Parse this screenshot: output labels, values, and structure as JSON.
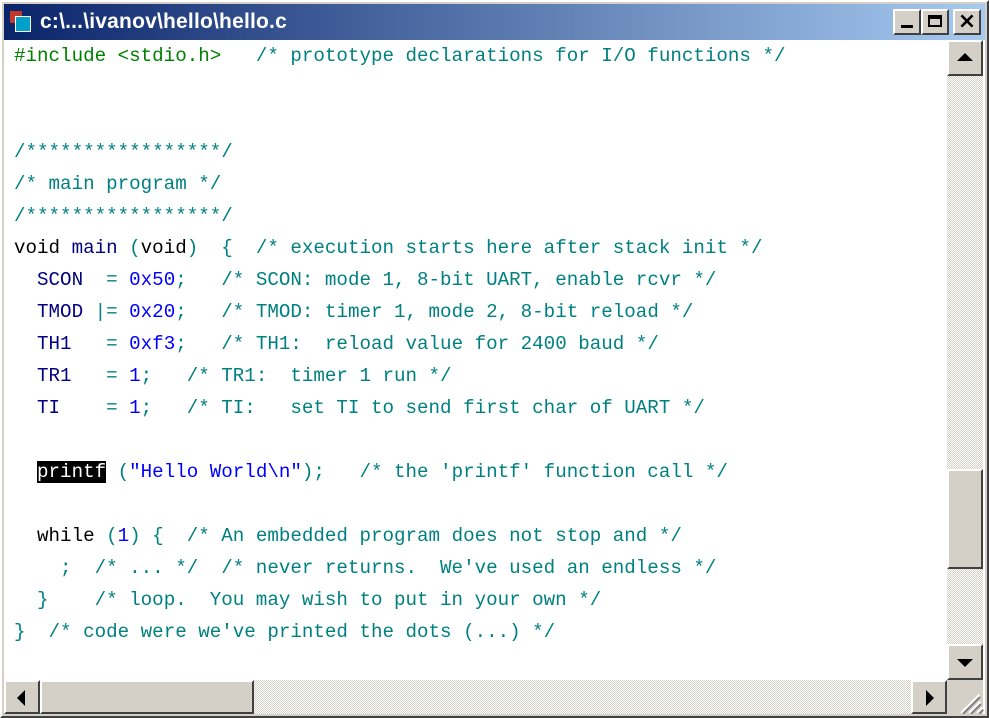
{
  "window": {
    "title": "c:\\...\\ivanov\\hello\\hello.c",
    "icon": "document-app-icon",
    "buttons": {
      "minimize": "minimize-icon",
      "maximize": "maximize-icon",
      "close": "×"
    }
  },
  "editor": {
    "colors": {
      "comment": "#008080",
      "preprocessor": "#008000",
      "keyword": "#000080",
      "number": "#0000ff",
      "selection": "#000000"
    },
    "lines": [
      {
        "tokens": [
          {
            "t": "#include <stdio.h>",
            "k": "pp"
          },
          {
            "t": "   ",
            "k": "op"
          },
          {
            "t": "/* prototype declarations for I/O functions */",
            "k": "cmt"
          }
        ]
      },
      {
        "tokens": []
      },
      {
        "tokens": []
      },
      {
        "tokens": [
          {
            "t": "/*****************/",
            "k": "cmt"
          }
        ]
      },
      {
        "tokens": [
          {
            "t": "/* main program */",
            "k": "cmt"
          }
        ]
      },
      {
        "tokens": [
          {
            "t": "/*****************/",
            "k": "cmt"
          }
        ]
      },
      {
        "tokens": [
          {
            "t": "void",
            "k": "op"
          },
          {
            "t": " ",
            "k": "op"
          },
          {
            "t": "main",
            "k": "kw"
          },
          {
            "t": " (",
            "k": "cmt"
          },
          {
            "t": "void",
            "k": "op"
          },
          {
            "t": ")  {  ",
            "k": "cmt"
          },
          {
            "t": "/* execution starts here after stack init */",
            "k": "cmt"
          }
        ]
      },
      {
        "tokens": [
          {
            "t": "  ",
            "k": "op"
          },
          {
            "t": "SCON",
            "k": "kw"
          },
          {
            "t": "  = ",
            "k": "cmt"
          },
          {
            "t": "0x50",
            "k": "num"
          },
          {
            "t": ";   ",
            "k": "cmt"
          },
          {
            "t": "/* SCON: mode 1, 8-bit UART, enable rcvr */",
            "k": "cmt"
          }
        ]
      },
      {
        "tokens": [
          {
            "t": "  ",
            "k": "op"
          },
          {
            "t": "TMOD",
            "k": "kw"
          },
          {
            "t": " |= ",
            "k": "cmt"
          },
          {
            "t": "0x20",
            "k": "num"
          },
          {
            "t": ";   ",
            "k": "cmt"
          },
          {
            "t": "/* TMOD: timer 1, mode 2, 8-bit reload */",
            "k": "cmt"
          }
        ]
      },
      {
        "tokens": [
          {
            "t": "  ",
            "k": "op"
          },
          {
            "t": "TH1",
            "k": "kw"
          },
          {
            "t": "   = ",
            "k": "cmt"
          },
          {
            "t": "0xf3",
            "k": "num"
          },
          {
            "t": ";   ",
            "k": "cmt"
          },
          {
            "t": "/* TH1:  reload value for 2400 baud */",
            "k": "cmt"
          }
        ]
      },
      {
        "tokens": [
          {
            "t": "  ",
            "k": "op"
          },
          {
            "t": "TR1",
            "k": "kw"
          },
          {
            "t": "   = ",
            "k": "cmt"
          },
          {
            "t": "1",
            "k": "num"
          },
          {
            "t": ";   ",
            "k": "cmt"
          },
          {
            "t": "/* TR1:  timer 1 run */",
            "k": "cmt"
          }
        ]
      },
      {
        "tokens": [
          {
            "t": "  ",
            "k": "op"
          },
          {
            "t": "TI",
            "k": "kw"
          },
          {
            "t": "    = ",
            "k": "cmt"
          },
          {
            "t": "1",
            "k": "num"
          },
          {
            "t": ";   ",
            "k": "cmt"
          },
          {
            "t": "/* TI:   set TI to send first char of UART */",
            "k": "cmt"
          }
        ]
      },
      {
        "tokens": []
      },
      {
        "tokens": [
          {
            "t": "  ",
            "k": "op"
          },
          {
            "t": "printf",
            "k": "sel"
          },
          {
            "t": " (",
            "k": "cmt"
          },
          {
            "t": "\"Hello World\\n\"",
            "k": "str"
          },
          {
            "t": ");   ",
            "k": "cmt"
          },
          {
            "t": "/* the 'printf' function call */",
            "k": "cmt"
          }
        ]
      },
      {
        "tokens": []
      },
      {
        "tokens": [
          {
            "t": "  ",
            "k": "op"
          },
          {
            "t": "while",
            "k": "op"
          },
          {
            "t": " (",
            "k": "cmt"
          },
          {
            "t": "1",
            "k": "num"
          },
          {
            "t": ") {  ",
            "k": "cmt"
          },
          {
            "t": "/* An embedded program does not stop and */",
            "k": "cmt"
          }
        ]
      },
      {
        "tokens": [
          {
            "t": "    ;  ",
            "k": "cmt"
          },
          {
            "t": "/* ... */  /* never returns.  We've used an endless */",
            "k": "cmt"
          }
        ]
      },
      {
        "tokens": [
          {
            "t": "  }    ",
            "k": "cmt"
          },
          {
            "t": "/* loop.  You may wish to put in your own */",
            "k": "cmt"
          }
        ]
      },
      {
        "tokens": [
          {
            "t": "}  ",
            "k": "cmt"
          },
          {
            "t": "/* code were we've printed the dots (...) */",
            "k": "cmt"
          }
        ]
      }
    ]
  },
  "scrollbars": {
    "vertical": {
      "up_icon": "arrow-up-icon",
      "down_icon": "arrow-down-icon",
      "position": 0.84
    },
    "horizontal": {
      "left_icon": "arrow-left-icon",
      "right_icon": "arrow-right-icon",
      "position": 0.0
    }
  }
}
